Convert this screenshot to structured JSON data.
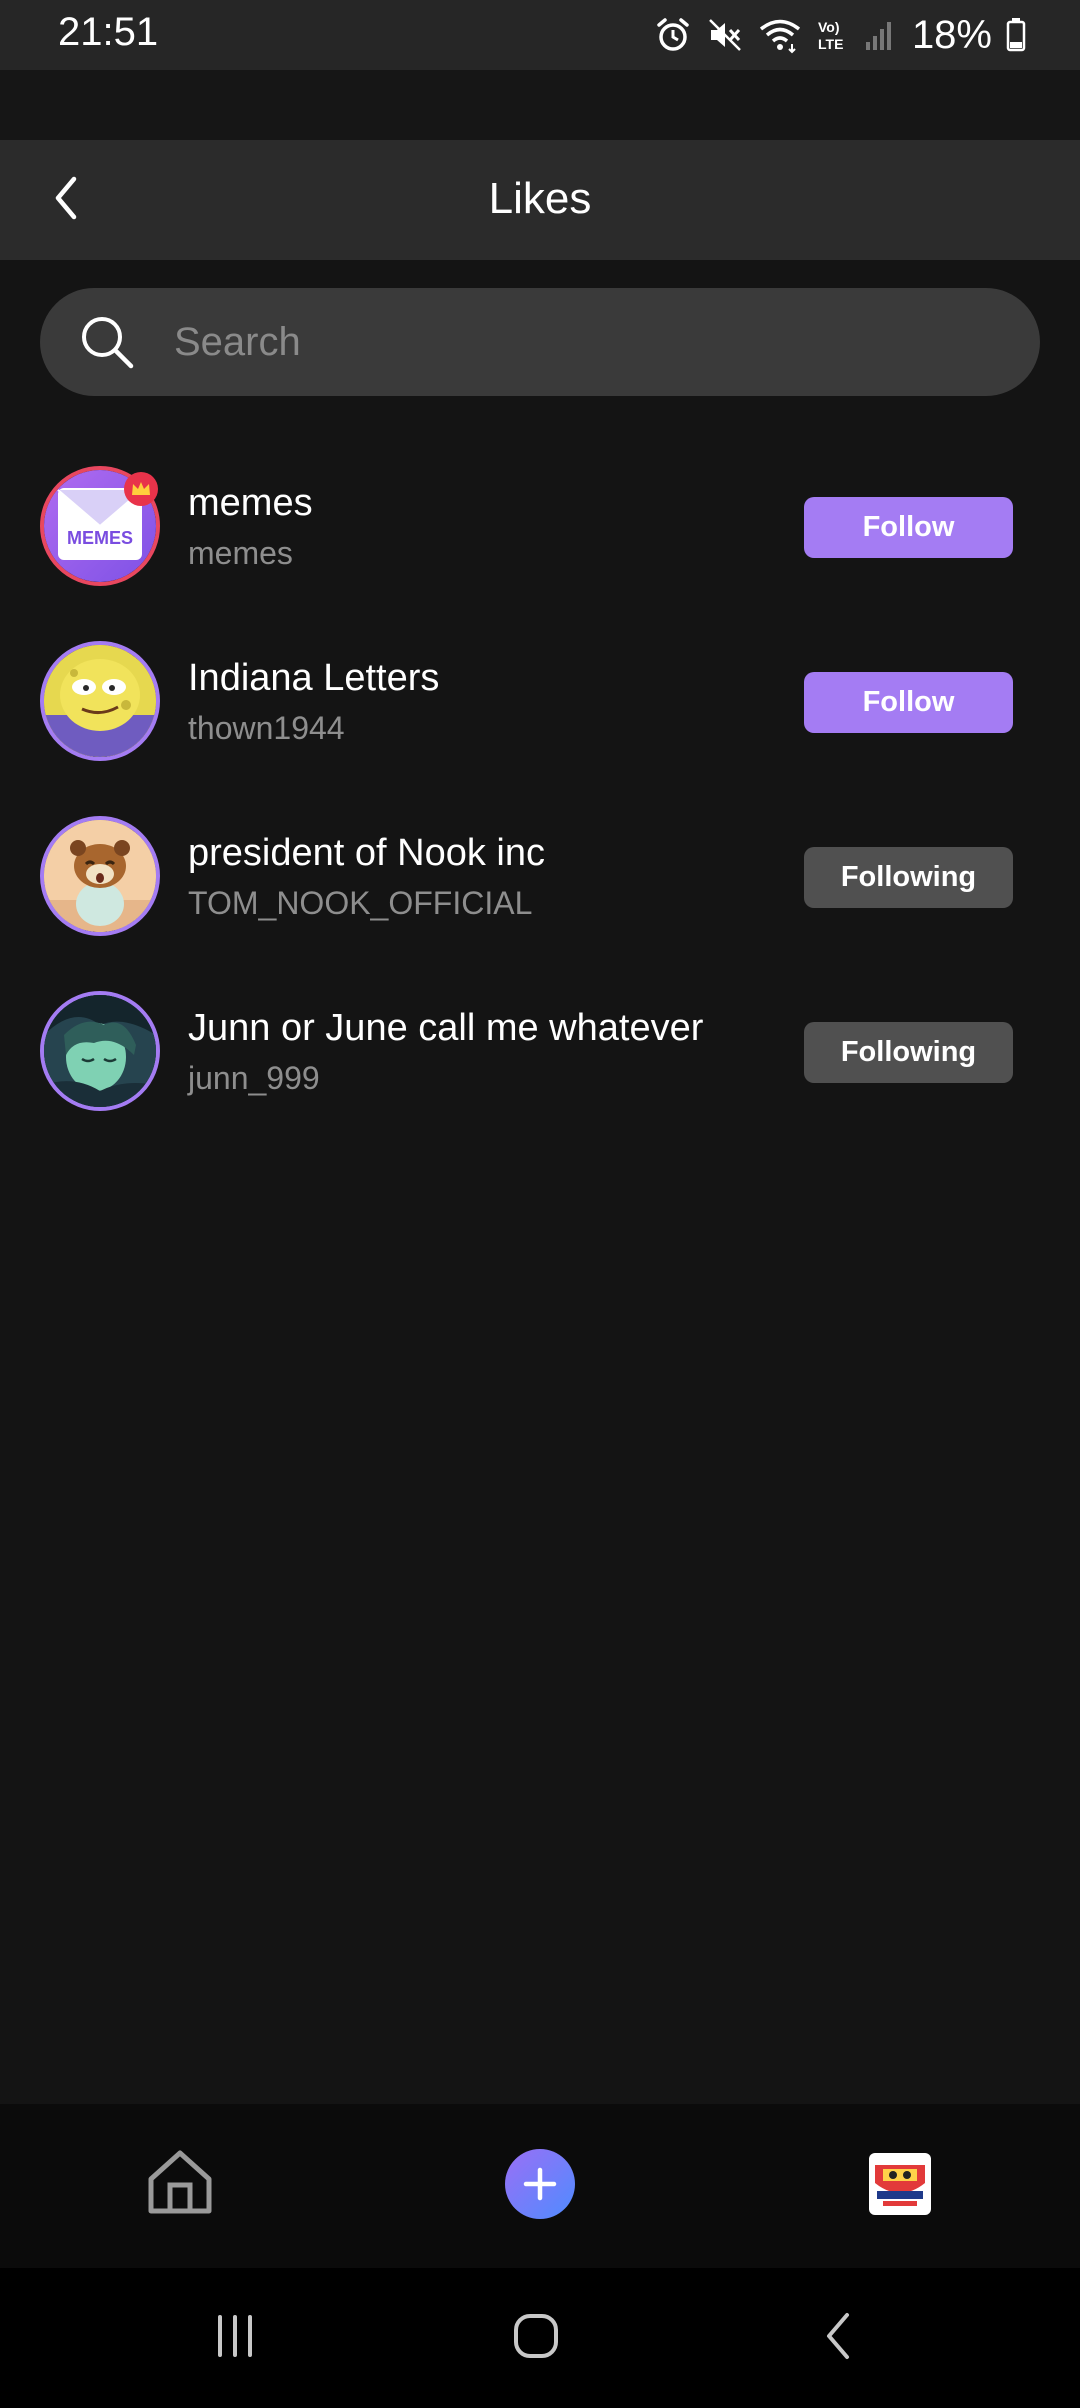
{
  "status_bar": {
    "time": "21:51",
    "battery": "18%",
    "icons": [
      "alarm-icon",
      "mute-icon",
      "wifi-icon",
      "volte-icon",
      "signal-icon",
      "battery-icon"
    ]
  },
  "header": {
    "title": "Likes",
    "back_icon": "chevron-left-icon"
  },
  "search": {
    "placeholder": "Search",
    "value": ""
  },
  "users": [
    {
      "name": "memes",
      "handle": "memes",
      "button": "Follow",
      "state": "follow",
      "avatar_text": "MEMES"
    },
    {
      "name": "Indiana Letters",
      "handle": "thown1944",
      "button": "Follow",
      "state": "follow"
    },
    {
      "name": "president of Nook inc",
      "handle": "TOM_NOOK_OFFICIAL",
      "button": "Following",
      "state": "following"
    },
    {
      "name": "Junn or June call me whatever",
      "handle": "junn_999",
      "button": "Following",
      "state": "following"
    }
  ],
  "bottom_nav": {
    "items": [
      "home-icon",
      "add-icon",
      "profile-icon"
    ]
  },
  "system_nav": {
    "items": [
      "recents-icon",
      "home-circle-icon",
      "back-icon"
    ]
  },
  "colors": {
    "background": "#141414",
    "follow_button": "#a47cf3",
    "following_button": "#505050",
    "header": "#2b2b2b",
    "search": "#3a3a3a"
  }
}
